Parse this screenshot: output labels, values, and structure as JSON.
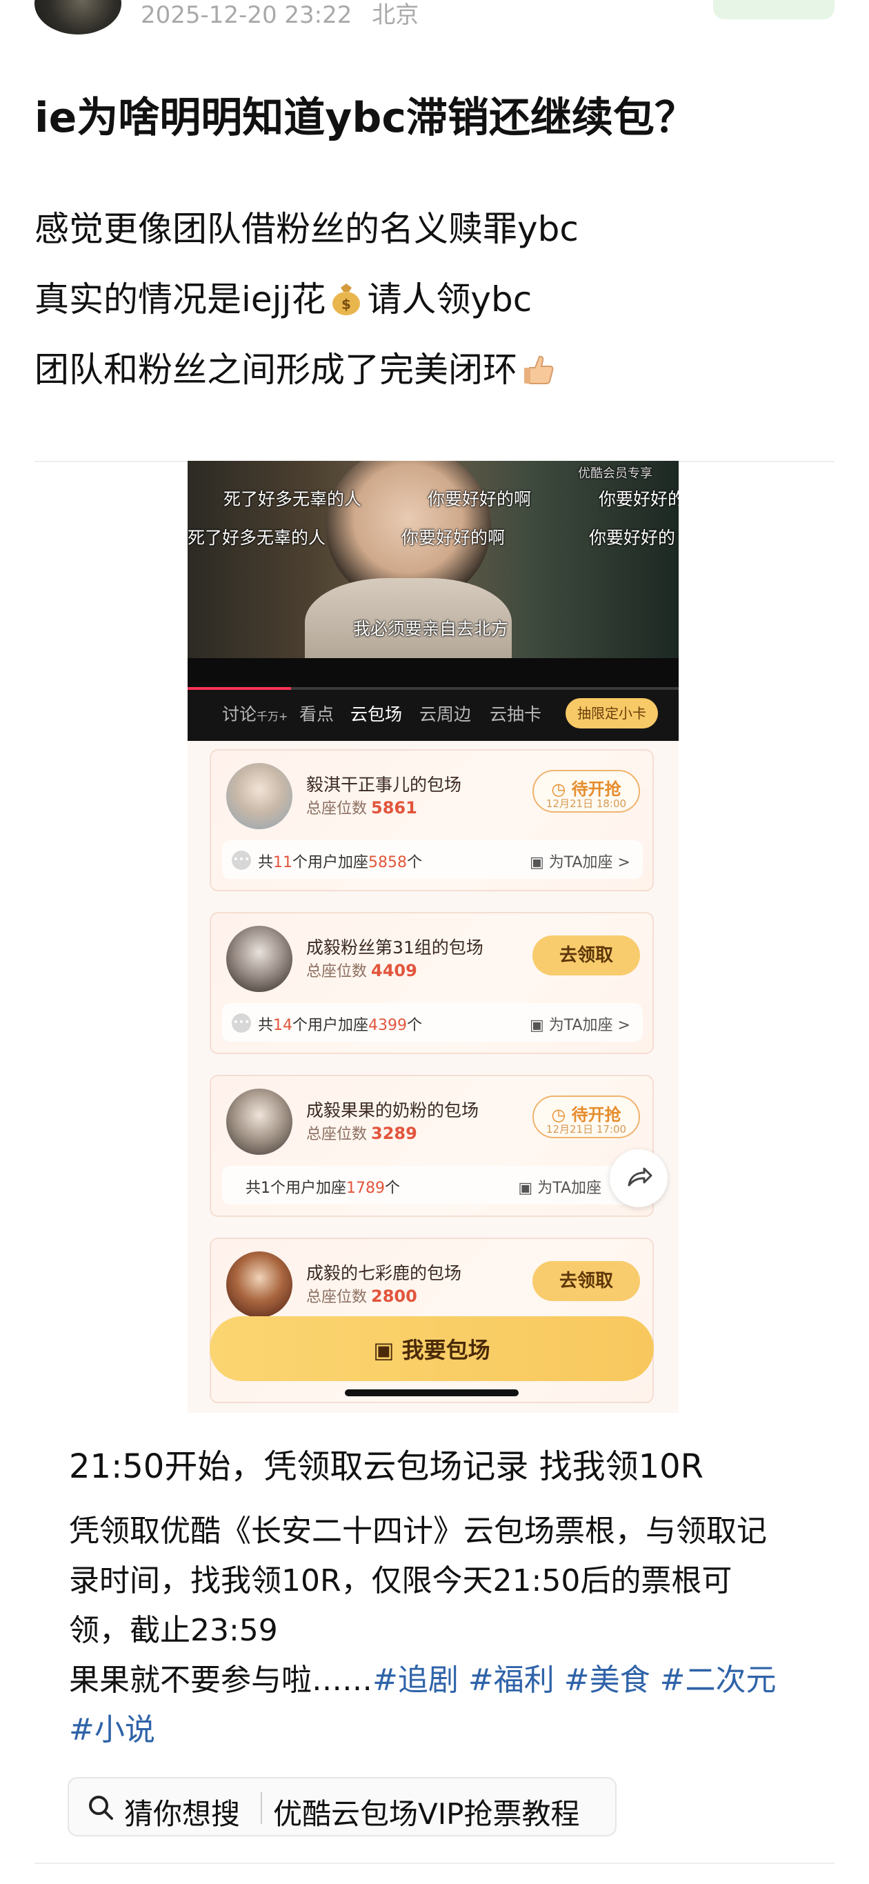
{
  "post": {
    "timestamp": "2025-12-20 23:22",
    "location": "北京",
    "title": "ie为啥明明知道ybc滞销还继续包？",
    "lines": {
      "l1": "感觉更像团队借粉丝的名义赎罪ybc",
      "l2_a": "真实的情况是iejj花",
      "l2_b": "请人领ybc",
      "l3": "团队和粉丝之间形成了完美闭环"
    }
  },
  "screenshot": {
    "video": {
      "danmaku": {
        "d1": "死了好多无辜的人",
        "d2": "你要好好的啊",
        "d3": "你要好好的",
        "d4": "死了好多无辜的人",
        "d5": "你要好好的啊",
        "d6": "你要好好的",
        "subtitle": "我必须要亲自去北方",
        "watermark": "优酷会员专享"
      },
      "tabs": {
        "discuss": "讨论",
        "discuss_count": "千万+",
        "highlights": "看点",
        "cloud_venue": "云包场",
        "cloud_merch": "云周边",
        "cloud_cards": "云抽卡",
        "limited_card": "抽限定小卡"
      }
    },
    "cards": [
      {
        "name": "毅淇干正事儿的包场",
        "seat_label": "总座位数",
        "seats": "5861",
        "button": "待开抢",
        "button_sub": "12月21日 18:00",
        "users_pre": "共",
        "users_n": "11",
        "users_mid": "个用户加座",
        "users_seats": "5858",
        "users_post": "个",
        "add": "为TA加座 >"
      },
      {
        "name": "成毅粉丝第31组的包场",
        "seat_label": "总座位数",
        "seats": "4409",
        "button": "去领取",
        "users_pre": "共",
        "users_n": "14",
        "users_mid": "个用户加座",
        "users_seats": "4399",
        "users_post": "个",
        "add": "为TA加座 >"
      },
      {
        "name": "成毅果果的奶粉的包场",
        "seat_label": "总座位数",
        "seats": "3289",
        "button": "待开抢",
        "button_sub": "12月21日 17:00",
        "users_pre": "共",
        "users_n": "1",
        "users_mid": "个用户加座",
        "users_seats": "1789",
        "users_post": "个",
        "add": "为TA加座"
      },
      {
        "name": "成毅的七彩鹿的包场",
        "seat_label": "总座位数",
        "seats": "2800",
        "button": "去领取"
      }
    ],
    "big_button": "我要包场"
  },
  "promo": {
    "headline": "21:50开始，凭领取云包场记录 找我领10R",
    "para_1": "凭领取优酷《长安二十四计》云包场票根，与领取记录时间，找我领10R，仅限今天21:50后的票根可领，截止23:59",
    "para_2": "果果就不要参与啦……",
    "tags": [
      "#追剧",
      "#福利",
      "#美食",
      "#二次元",
      "#小说"
    ]
  },
  "search": {
    "prompt": "猜你想搜",
    "term": "优酷云包场VIP抢票教程"
  },
  "colors": {
    "accent_orange": "#e58c2b",
    "seat_red": "#e2553c",
    "button_yellow": "#f8cc6d",
    "tag_blue": "#2f63a8"
  }
}
